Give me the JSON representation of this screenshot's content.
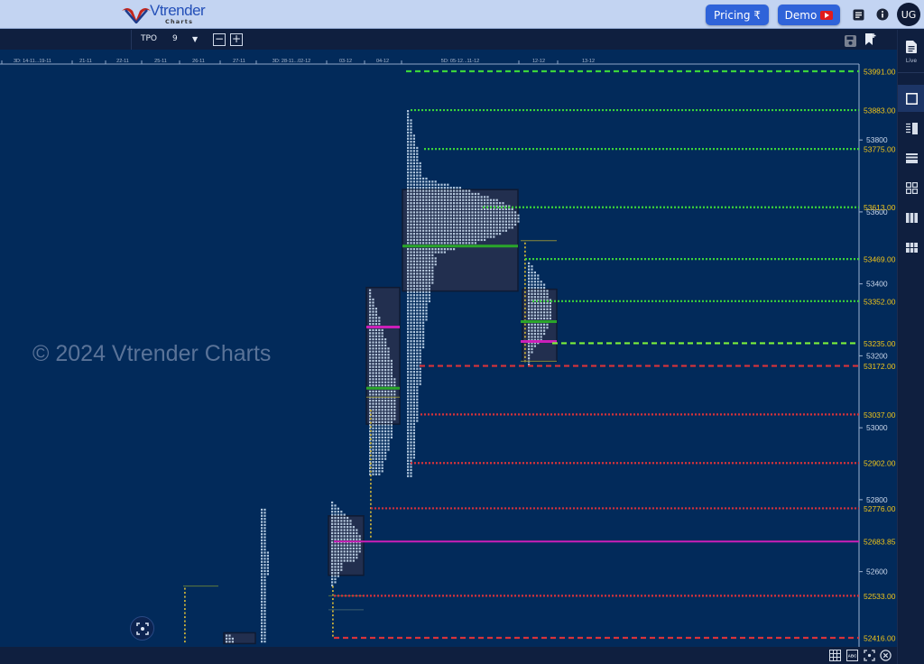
{
  "header": {
    "logo_text": "Vtrender",
    "logo_subtext": "Charts",
    "pricing_label": "Pricing ₹",
    "demo_label": "Demo",
    "avatar_initials": "UG",
    "icons": [
      "notes-icon",
      "info-icon"
    ]
  },
  "toolbar": {
    "mode_label": "TPO",
    "tpo_value": "9",
    "zoom_out_label": "−",
    "zoom_in_label": "+",
    "icons": [
      "save-icon",
      "bookmark-add-icon"
    ]
  },
  "rightbar": {
    "live_label": "Live",
    "items": [
      "live-notes-icon",
      "single-box-icon",
      "split-profile-icon",
      "stacked-rows-icon",
      "grid-four-icon",
      "columns-icon",
      "grid-nine-icon"
    ]
  },
  "bottombar": {
    "icons": [
      "grid-icon",
      "abc-icon",
      "focus-icon",
      "close-circle-icon"
    ]
  },
  "watermark": "© 2024 Vtrender Charts",
  "colors": {
    "background": "#022a5a",
    "ibh_ibl_green": "#3bd43b",
    "lime_dashed": "#7cf03a",
    "red_level": "#d7333a",
    "poc_green": "#2aa52a",
    "vwap_magenta": "#cc1fb8",
    "price_label": "#f0c419",
    "axis_tick_label": "#c9d6ea",
    "tpo_letter": "#cfe2f5",
    "value_area_box": "#24304f"
  },
  "chart_data": {
    "type": "tpo-market-profile",
    "title": "",
    "xlabel": "",
    "ylabel": "",
    "ylim": [
      52400,
      54010
    ],
    "date_labels": [
      "3D: 14-11...19-11",
      "21-11",
      "22-11",
      "25-11",
      "26-11",
      "27-11",
      "3D: 28-11...02-12",
      "03-12",
      "04-12",
      "5D: 05-12...11-12",
      "12-12",
      "13-12"
    ],
    "axis_ticks": [
      53800,
      53600,
      53400,
      53200,
      53000,
      52800,
      52600
    ],
    "reference_levels": [
      {
        "price": 53991.0,
        "label": "53991.00",
        "color": "green",
        "style": "dashed"
      },
      {
        "price": 53883.0,
        "label": "53883.00",
        "color": "green",
        "style": "dotted"
      },
      {
        "price": 53775.0,
        "label": "53775.00",
        "color": "green",
        "style": "dotted"
      },
      {
        "price": 53613.0,
        "label": "53613.00",
        "color": "green",
        "style": "dotted"
      },
      {
        "price": 53469.0,
        "label": "53469.00",
        "color": "green",
        "style": "dotted"
      },
      {
        "price": 53352.0,
        "label": "53352.00",
        "color": "green",
        "style": "dotted"
      },
      {
        "price": 53235.0,
        "label": "53235.00",
        "color": "lime",
        "style": "dashed"
      },
      {
        "price": 53172.0,
        "label": "53172.00",
        "color": "red",
        "style": "dashed"
      },
      {
        "price": 53037.0,
        "label": "53037.00",
        "color": "red",
        "style": "dotted"
      },
      {
        "price": 52902.0,
        "label": "52902.00",
        "color": "red",
        "style": "dotted"
      },
      {
        "price": 52776.0,
        "label": "52776.00",
        "color": "red",
        "style": "dotted"
      },
      {
        "price": 52683.85,
        "label": "52683.85",
        "color": "magenta",
        "style": "solid"
      },
      {
        "price": 52533.0,
        "label": "52533.00",
        "color": "red",
        "style": "dotted"
      },
      {
        "price": 52416.0,
        "label": "52416.00",
        "color": "red",
        "style": "dashed"
      }
    ],
    "profiles": [
      {
        "session": "26-11",
        "high": 52560,
        "low": 52400,
        "type": "ib-stick"
      },
      {
        "session": "27-11",
        "high": 52430,
        "low": 52400,
        "va_high": 52430,
        "va_low": 52400
      },
      {
        "session": "3D: 28-11...02-12",
        "high": 52780,
        "low": 52400,
        "width": 0.25
      },
      {
        "session": "03-12",
        "high": 52795,
        "low": 52416,
        "va_high": 52755,
        "va_low": 52590,
        "poc": 52665,
        "vwap": 52690
      },
      {
        "session": "04-12",
        "high": 53390,
        "low": 52700,
        "va_high": 53390,
        "va_low": 53010,
        "poc": 53110,
        "vwap": 53270
      },
      {
        "session": "5D: 05-12...11-12",
        "high": 53883,
        "low": 52860,
        "va_high": 53662,
        "va_low": 53380,
        "poc": 53505
      },
      {
        "session": "12-12",
        "high": 53520,
        "low": 53178,
        "va_high": 53385,
        "va_low": 53185,
        "poc": 53295,
        "vwap": 53240
      }
    ]
  }
}
